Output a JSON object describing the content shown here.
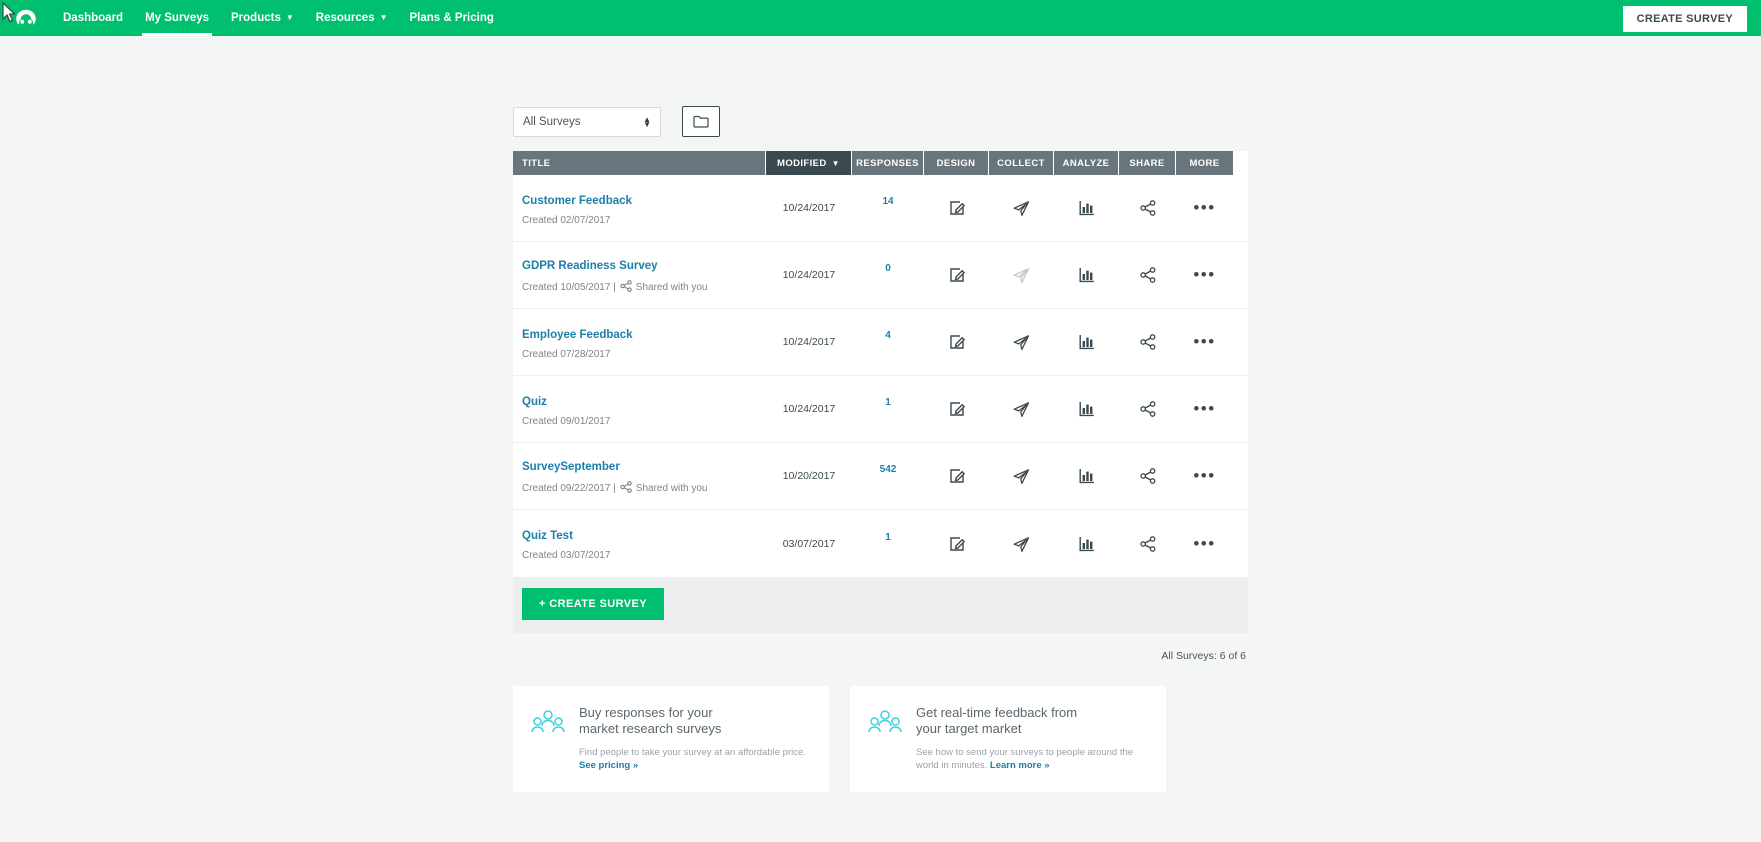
{
  "colors": {
    "brand_green": "#00bf6f",
    "header_gray": "#69757c",
    "header_active": "#3b4950",
    "link_blue": "#1d7ea9",
    "promo_icon": "#3ecfe0",
    "page_bg": "#f4f5f5"
  },
  "nav": {
    "logo_icon": "surveymonkey-logo-icon",
    "items": [
      {
        "label": "Dashboard",
        "active": false,
        "has_caret": false
      },
      {
        "label": "My Surveys",
        "active": true,
        "has_caret": false
      },
      {
        "label": "Products",
        "active": false,
        "has_caret": true
      },
      {
        "label": "Resources",
        "active": false,
        "has_caret": true
      },
      {
        "label": "Plans & Pricing",
        "active": false,
        "has_caret": false
      }
    ],
    "create_survey_label": "CREATE SURVEY"
  },
  "filter": {
    "selected": "All Surveys",
    "folder_icon": "folder-icon"
  },
  "table": {
    "headers": {
      "title": "TITLE",
      "modified": "MODIFIED",
      "sort_caret": "▼",
      "responses": "RESPONSES",
      "design": "DESIGN",
      "collect": "COLLECT",
      "analyze": "ANALYZE",
      "share": "SHARE",
      "more": "MORE"
    },
    "icons": {
      "design": "edit-square-icon",
      "collect": "paper-plane-icon",
      "analyze": "bar-chart-icon",
      "share": "share-nodes-icon",
      "more": "ellipsis-icon"
    },
    "more_glyph": "•••",
    "shared_label": "Shared with you",
    "rows": [
      {
        "title": "Customer Feedback",
        "created": "Created 02/07/2017",
        "shared": false,
        "modified": "10/24/2017",
        "responses": "14",
        "collect_disabled": false
      },
      {
        "title": "GDPR Readiness Survey",
        "created": "Created 10/05/2017 |",
        "shared": true,
        "modified": "10/24/2017",
        "responses": "0",
        "collect_disabled": true
      },
      {
        "title": "Employee Feedback",
        "created": "Created 07/28/2017",
        "shared": false,
        "modified": "10/24/2017",
        "responses": "4",
        "collect_disabled": false
      },
      {
        "title": "Quiz",
        "created": "Created 09/01/2017",
        "shared": false,
        "modified": "10/24/2017",
        "responses": "1",
        "collect_disabled": false
      },
      {
        "title": "SurveySeptember",
        "created": "Created 09/22/2017 |",
        "shared": true,
        "modified": "10/20/2017",
        "responses": "542",
        "collect_disabled": false
      },
      {
        "title": "Quiz Test",
        "created": "Created 03/07/2017",
        "shared": false,
        "modified": "03/07/2017",
        "responses": "1",
        "collect_disabled": false
      }
    ],
    "create_survey_label": "+ CREATE SURVEY",
    "count_label": "All Surveys: 6 of 6"
  },
  "promos": [
    {
      "icon": "people-group-icon",
      "heading_line1": "Buy responses for your",
      "heading_line2": "market research surveys",
      "body": "Find people to take your survey at an affordable price.",
      "link": "See pricing »"
    },
    {
      "icon": "people-group-icon",
      "heading_line1": "Get real-time feedback from",
      "heading_line2": "your target market",
      "body": "See how to send your surveys to people around the world in minutes.",
      "link": "Learn more »"
    }
  ]
}
